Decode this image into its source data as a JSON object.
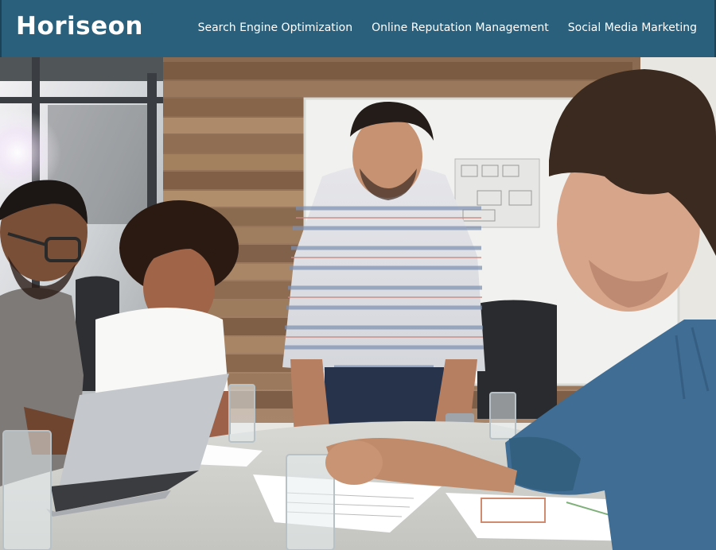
{
  "header": {
    "logo_text": "Horiseon",
    "nav": [
      {
        "label": "Search Engine Optimization"
      },
      {
        "label": "Online Reputation Management"
      },
      {
        "label": "Social Media Marketing"
      }
    ]
  },
  "hero": {
    "icon": "team-meeting-photo"
  },
  "colors": {
    "header_bg": "#2a607c",
    "nav_text": "#ffffff",
    "logo_text": "#ffffff"
  }
}
